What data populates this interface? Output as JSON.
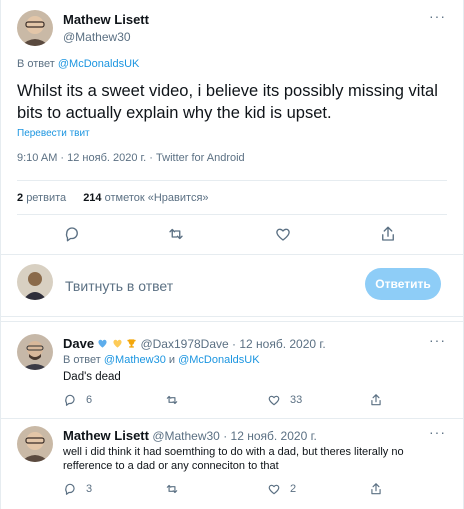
{
  "main_tweet": {
    "author_name": "Mathew Lisett",
    "author_handle": "@Mathew30",
    "reply_prefix": "В ответ",
    "reply_to": "@McDonaldsUK",
    "text": "Whilst its a sweet video, i believe its possibly missing vital bits to actually explain why the kid is upset.",
    "translate_label": "Перевести твит",
    "meta": "9:10 AM · 12 нояб. 2020 г. · Twitter for Android",
    "retweets_count": "2",
    "retweets_label": "ретвита",
    "likes_count": "214",
    "likes_label": "отметок «Нравится»"
  },
  "reply_box": {
    "placeholder": "Твитнуть в ответ",
    "button_label": "Ответить"
  },
  "replies": [
    {
      "author_name": "Dave",
      "author_handle": "@Dax1978Dave",
      "date": "· 12 нояб. 2020 г.",
      "reply_prefix": "В ответ",
      "reply_to_1": "@Mathew30",
      "reply_and": "и",
      "reply_to_2": "@McDonaldsUK",
      "text": "Dad's dead",
      "replies_count": "6",
      "likes_count": "33"
    },
    {
      "author_name": "Mathew Lisett",
      "author_handle": "@Mathew30",
      "date": "· 12 нояб. 2020 г.",
      "text": "well i did think it had soemthing to do with a dad, but theres literally no refference to a dad or any conneciton to that",
      "replies_count": "3",
      "likes_count": "2"
    }
  ],
  "colors": {
    "accent": "#1b95e0",
    "reply_button_disabled": "#8ecdf7",
    "muted_text": "#5b7083",
    "divider": "#e6ecf0"
  },
  "icons": [
    "more-icon",
    "reply-icon",
    "retweet-icon",
    "like-icon",
    "share-icon",
    "heart-emoji",
    "heart-emoji",
    "trophy-emoji"
  ]
}
